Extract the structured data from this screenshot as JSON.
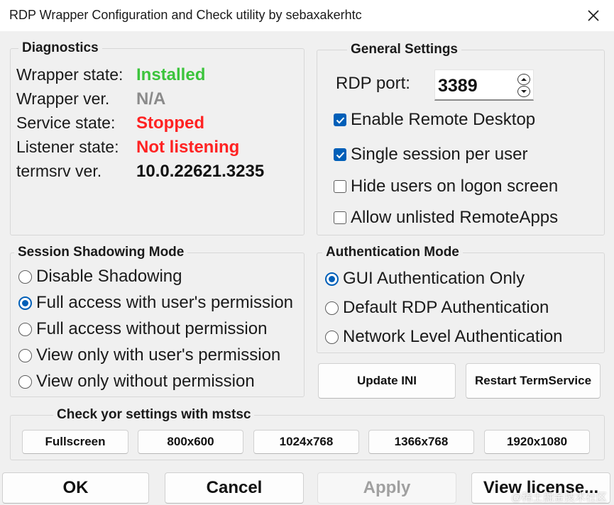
{
  "window": {
    "title": "RDP Wrapper Configuration and Check utility by sebaxakerhtc"
  },
  "diagnostics": {
    "legend": "Diagnostics",
    "rows": [
      {
        "label": "Wrapper state:",
        "value": "Installed",
        "color": "#3cc43c"
      },
      {
        "label": "Wrapper ver.",
        "value": "N/A",
        "color": "#8a8a8a"
      },
      {
        "label": "Service state:",
        "value": "Stopped",
        "color": "#ff2222"
      },
      {
        "label": "Listener state:",
        "value": "Not listening",
        "color": "#ff2222"
      },
      {
        "label": "termsrv ver.",
        "value": "10.0.22621.3235",
        "color": "#111111"
      }
    ]
  },
  "general": {
    "legend": "General Settings",
    "port_label": "RDP port:",
    "port_value": "3389",
    "options": [
      {
        "label": "Enable Remote Desktop",
        "checked": true
      },
      {
        "label": "Single session per user",
        "checked": true
      },
      {
        "label": "Hide users on logon screen",
        "checked": false
      },
      {
        "label": "Allow unlisted RemoteApps",
        "checked": false
      }
    ]
  },
  "shadowing": {
    "legend": "Session Shadowing Mode",
    "options": [
      {
        "label": "Disable Shadowing",
        "selected": false
      },
      {
        "label": "Full access with user's permission",
        "selected": true
      },
      {
        "label": "Full access without permission",
        "selected": false
      },
      {
        "label": "View only with user's permission",
        "selected": false
      },
      {
        "label": "View only without permission",
        "selected": false
      }
    ]
  },
  "auth": {
    "legend": "Authentication Mode",
    "options": [
      {
        "label": "GUI Authentication Only",
        "selected": true
      },
      {
        "label": "Default RDP Authentication",
        "selected": false
      },
      {
        "label": "Network Level Authentication",
        "selected": false
      }
    ]
  },
  "actions": {
    "update_ini": "Update INI",
    "restart_service": "Restart TermService"
  },
  "mstsc": {
    "legend": "Check yor settings with mstsc",
    "buttons": [
      "Fullscreen",
      "800x600",
      "1024x768",
      "1366x768",
      "1920x1080"
    ]
  },
  "footer": {
    "ok": "OK",
    "cancel": "Cancel",
    "apply": "Apply",
    "view_license": "View license..."
  },
  "watermark": "@稀土掘金技术社区",
  "colors": {
    "accent": "#005fb8",
    "installed": "#3cc43c",
    "stopped": "#ff2222",
    "na": "#8a8a8a"
  }
}
